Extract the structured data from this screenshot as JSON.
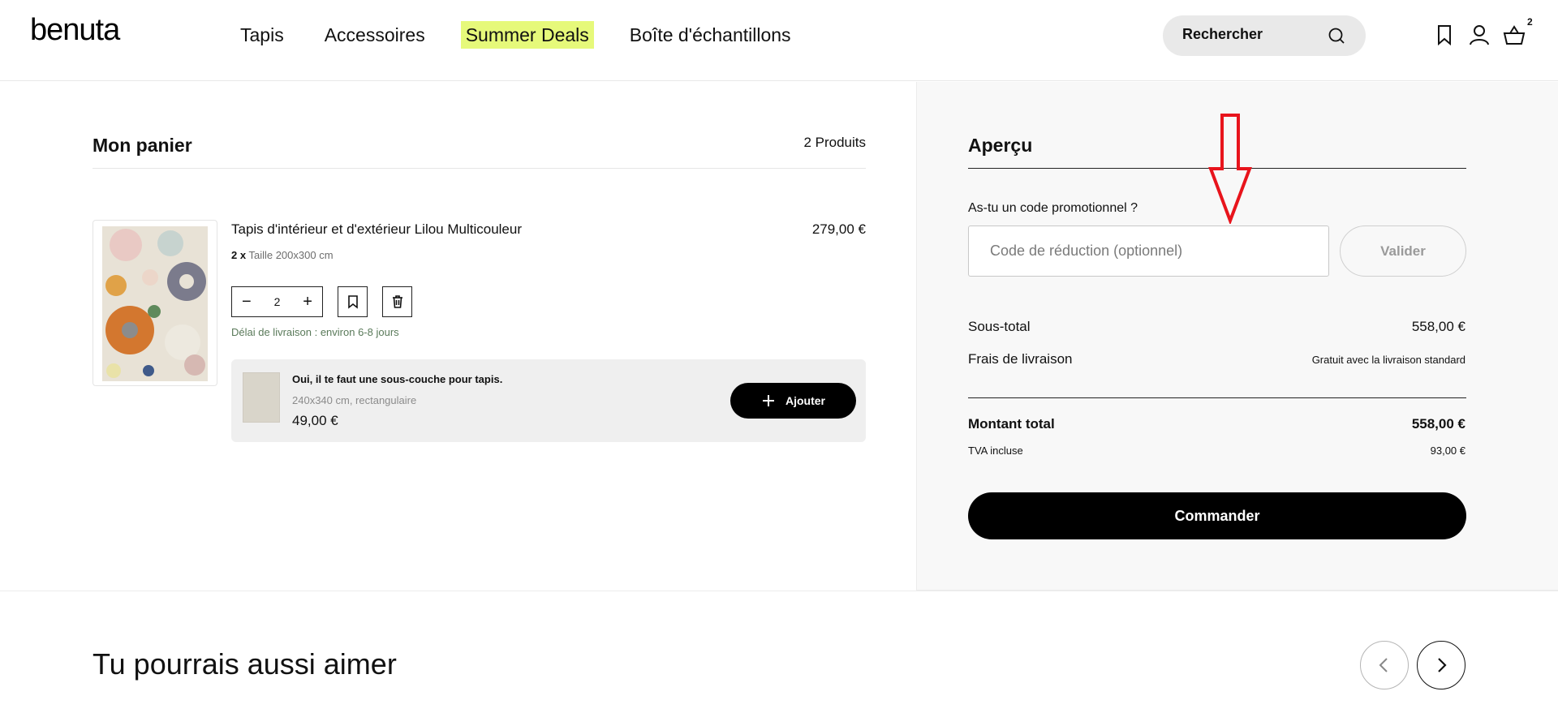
{
  "header": {
    "logo": "benuta",
    "nav": [
      "Tapis",
      "Accessoires",
      "Summer Deals",
      "Boîte d'échantillons"
    ],
    "search_label": "Rechercher",
    "cart_count": "2",
    "highlight_color": "#e6f97a"
  },
  "cart": {
    "title": "Mon panier",
    "count_label": "2 Produits",
    "item": {
      "name": "Tapis d'intérieur et d'extérieur Lilou Multicouleur",
      "price": "279,00 €",
      "qty_prefix": "2 x",
      "size": "Taille 200x300 cm",
      "quantity": "2",
      "delivery": "Délai de livraison : environ 6-8 jours"
    },
    "upsell": {
      "title": "Oui, il te faut une sous-couche pour tapis.",
      "subtitle": "240x340 cm, rectangulaire",
      "price": "49,00 €",
      "add_label": "Ajouter"
    }
  },
  "summary": {
    "title": "Aperçu",
    "promo_label": "As-tu un code promotionnel ?",
    "promo_placeholder": "Code de réduction (optionnel)",
    "validate_label": "Valider",
    "subtotal_label": "Sous-total",
    "subtotal_value": "558,00 €",
    "shipping_label": "Frais de livraison",
    "shipping_value": "Gratuit avec la livraison standard",
    "total_label": "Montant total",
    "total_value": "558,00 €",
    "vat_label": "TVA incluse",
    "vat_value": "93,00 €",
    "checkout_label": "Commander"
  },
  "recommendations": {
    "title": "Tu pourrais aussi aimer"
  }
}
